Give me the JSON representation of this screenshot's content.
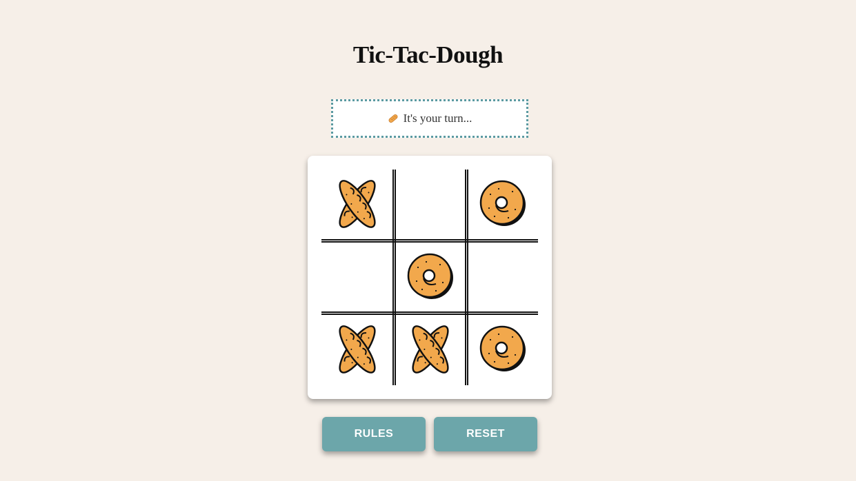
{
  "header": {
    "title": "Tic-Tac-Dough"
  },
  "status": {
    "icon": "baguette-icon",
    "text": "It's your turn..."
  },
  "board": {
    "cells": [
      "baguette",
      "",
      "bagel",
      "",
      "bagel",
      "",
      "baguette",
      "baguette",
      "bagel"
    ]
  },
  "buttons": {
    "rules_label": "RULES",
    "reset_label": "RESET"
  },
  "colors": {
    "background": "#f6efe8",
    "accent": "#6ca6aa",
    "status_border": "#5b9aa1",
    "pastry_fill": "#f2a84c"
  }
}
